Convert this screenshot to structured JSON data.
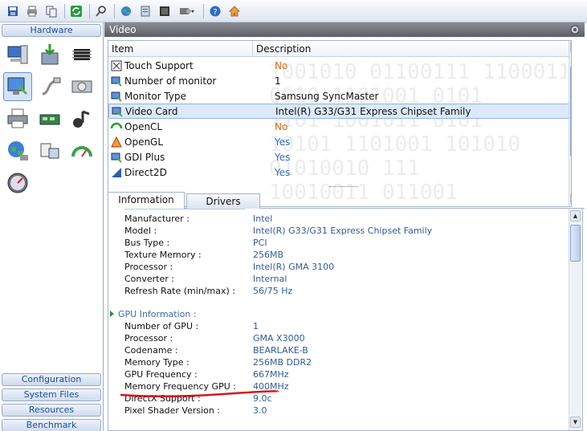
{
  "toolbar": {
    "icons": [
      "save-icon",
      "print-icon",
      "copy-icon",
      "refresh-icon",
      "search-icon",
      "globe-icon",
      "report-icon",
      "module-icon",
      "settings-dropdown-icon",
      "help-icon",
      "home-icon"
    ]
  },
  "sidebar": {
    "hardware_label": "Hardware",
    "bottom_buttons": [
      "Configuration",
      "System Files",
      "Resources",
      "Benchmark"
    ]
  },
  "main": {
    "title": "Video",
    "list": {
      "col_item": "Item",
      "col_desc": "Description",
      "rows": [
        {
          "name": "Touch Support",
          "value": "No",
          "value_color": "#e06a10",
          "icon": "touch-icon"
        },
        {
          "name": "Number of monitor",
          "value": "1",
          "value_color": "#111111",
          "icon": "monitor-icon"
        },
        {
          "name": "Monitor Type",
          "value": "Samsung SyncMaster",
          "value_color": "#111111",
          "icon": "monitor-icon"
        },
        {
          "name": "Video Card",
          "value": "Intel(R) G33/G31 Express Chipset Family",
          "value_color": "#111111",
          "icon": "video-card-icon",
          "selected": true
        },
        {
          "name": "OpenCL",
          "value": "No",
          "value_color": "#e06a10",
          "icon": "opencl-icon"
        },
        {
          "name": "OpenGL",
          "value": "Yes",
          "value_color": "#2f6fc0",
          "icon": "opengl-icon"
        },
        {
          "name": "GDI Plus",
          "value": "Yes",
          "value_color": "#2f6fc0",
          "icon": "gdi-icon"
        },
        {
          "name": "Direct2D",
          "value": "Yes",
          "value_color": "#2f6fc0",
          "icon": "direct2d-icon"
        }
      ]
    },
    "tabs": [
      "Information",
      "Drivers"
    ],
    "info": {
      "general_rows": [
        {
          "k": "Manufacturer :",
          "v": "Intel"
        },
        {
          "k": "Model :",
          "v": "Intel(R) G33/G31 Express Chipset Family"
        },
        {
          "k": "Bus Type :",
          "v": "PCI"
        },
        {
          "k": "Texture Memory :",
          "v": "256MB"
        },
        {
          "k": "Processor :",
          "v": "Intel(R) GMA 3100"
        },
        {
          "k": "Converter :",
          "v": "Internal"
        },
        {
          "k": "Refresh Rate (min/max) :",
          "v": "56/75 Hz"
        }
      ],
      "gpu_section": "GPU Information :",
      "gpu_rows": [
        {
          "k": "Number of GPU :",
          "v": "1"
        },
        {
          "k": "Processor :",
          "v": "GMA X3000"
        },
        {
          "k": "Codename :",
          "v": "BEARLAKE-B"
        },
        {
          "k": "Memory Type :",
          "v": "256MB DDR2"
        },
        {
          "k": "GPU Frequency :",
          "v": "667MHz"
        },
        {
          "k": "Memory Frequency GPU :",
          "v": "400MHz"
        },
        {
          "k": "DirectX Support :",
          "v": "9.0c"
        },
        {
          "k": "Pixel Shader Version :",
          "v": "3.0"
        }
      ]
    }
  },
  "colors": {
    "accent": "#1a4fa0",
    "link_value": "#2f5c9c",
    "selection": "#dbe9fb",
    "annotation": "#d9141c"
  }
}
